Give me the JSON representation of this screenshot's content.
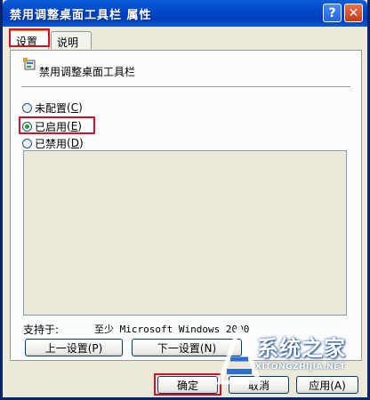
{
  "window": {
    "title": "禁用调整桌面工具栏 属性",
    "help_glyph": "?",
    "close_glyph": "✕"
  },
  "tabs": [
    {
      "label": "设置"
    },
    {
      "label": "说明"
    }
  ],
  "policy": {
    "name": "禁用调整桌面工具栏",
    "icon": "policy-icon"
  },
  "options": [
    {
      "label": "未配置",
      "key": "C",
      "selected": false
    },
    {
      "label": "已启用",
      "key": "E",
      "selected": true
    },
    {
      "label": "已禁用",
      "key": "D",
      "selected": false
    }
  ],
  "support": {
    "label": "支持于:",
    "value": "至少 Microsoft Windows 2000"
  },
  "nav": {
    "prev": "上一设置(P)",
    "next": "下一设置(N)"
  },
  "footer": {
    "ok": "确定",
    "cancel": "取消",
    "apply": "应用(A)"
  },
  "watermark": {
    "text": "系统之家",
    "url": "XITONGZHIJIA.NET"
  },
  "colors": {
    "highlight": "#d60e24",
    "titlebar": "#0045c8"
  }
}
